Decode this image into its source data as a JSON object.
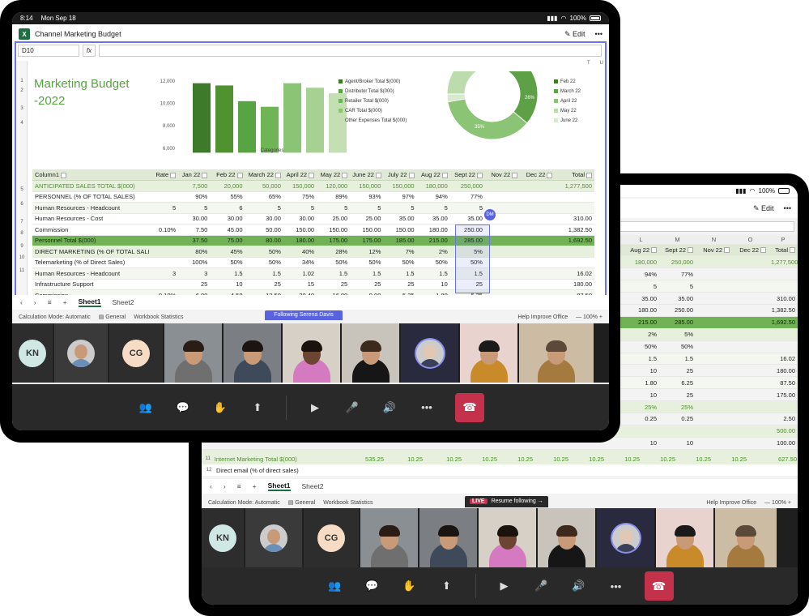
{
  "back": {
    "status": {
      "battery": "100%"
    },
    "title": {
      "edit": "Edit",
      "more": "•••"
    },
    "col_letters": [
      "K",
      "L",
      "M",
      "N",
      "O",
      "P"
    ],
    "header": [
      "Aug 22",
      "Sept 22",
      "Nov 22",
      "Dec 22",
      "Total"
    ],
    "rows": [
      [
        "180,000",
        "250,000",
        "",
        "",
        "1,277,500"
      ],
      [
        "94%",
        "77%",
        "",
        "",
        ""
      ],
      [
        "5",
        "5",
        "",
        "",
        ""
      ],
      [
        "35.00",
        "35.00",
        "",
        "",
        "310.00"
      ],
      [
        "180.00",
        "250.00",
        "",
        "",
        "1,382.50"
      ],
      [
        "215.00",
        "285.00",
        "",
        "",
        "1,692.50"
      ],
      [
        "2%",
        "5%",
        "",
        "",
        ""
      ],
      [
        "50%",
        "50%",
        "",
        "",
        ""
      ],
      [
        "1.5",
        "1.5",
        "",
        "",
        "16.02"
      ],
      [
        "10",
        "25",
        "",
        "",
        "180.00"
      ],
      [
        "1.80",
        "6.25",
        "",
        "",
        "87.50"
      ],
      [
        "10",
        "25",
        "",
        "",
        "175.00"
      ],
      [
        "25%",
        "25%",
        "",
        "",
        ""
      ],
      [
        "0.25",
        "0.25",
        "",
        "",
        "2.50"
      ],
      [
        "",
        "",
        "",
        "",
        "500.00"
      ],
      [
        "10",
        "10",
        "",
        "",
        "100.00"
      ],
      [
        "",
        "",
        "",
        "",
        "25.00"
      ]
    ],
    "internet_row": {
      "num": "11",
      "label": "Internet Marketing Total $(000)",
      "vals": [
        "535.25",
        "10.25",
        "10.25",
        "10.25",
        "10.25",
        "10.25",
        "10.25",
        "10.25",
        "10.25",
        "10.25",
        "10.25",
        "627.50"
      ]
    },
    "direct_row": {
      "num": "12",
      "label": "Direct email (% of direct sales)"
    },
    "sheets": [
      "Sheet1",
      "Sheet2"
    ],
    "statusbar": {
      "calc": "Calculation Mode: Automatic",
      "general": "General",
      "stats": "Workbook Statistics",
      "help": "Help Improve Office",
      "zoom": "100%"
    },
    "resume": {
      "live": "LIVE",
      "label": "Resume following"
    }
  },
  "front": {
    "status": {
      "time": "8:14",
      "date": "Mon Sep 18",
      "battery": "100%"
    },
    "title": {
      "app": "Channel Marketing Budget",
      "edit": "Edit",
      "more": "•••"
    },
    "cellref": "D10",
    "fx": "fx",
    "sheet_title": [
      "Marketing Budget",
      "-2022"
    ],
    "bar_chart": {
      "ylabels": [
        "12,000",
        "10,000",
        "8,000",
        "6,000"
      ],
      "xlabel": "Categories",
      "values": [
        11800,
        11600,
        10200,
        9700,
        11800,
        11400,
        10900
      ]
    },
    "bar_legend": [
      "Agent/Broker Total $(000)",
      "Distributor Total $(000)",
      "Retailer Total $(000)",
      "CAR Total $(000)",
      "Other Expenses Total $(000)"
    ],
    "pie": {
      "labels": [
        "26%",
        "35%"
      ]
    },
    "pie_legend": [
      "Feb 22",
      "March 22",
      "April 22",
      "May 22",
      "June 22"
    ],
    "col_letters_right": [
      "T",
      "U"
    ],
    "header": [
      "Column1",
      "Rate",
      "Jan 22",
      "Feb 22",
      "March 22",
      "April 22",
      "May 22",
      "June 22",
      "July 22",
      "Aug 22",
      "Sept 22",
      "Nov 22",
      "Dec 22",
      "Total"
    ],
    "rows": [
      {
        "c": "ant",
        "v": [
          "ANTICIPATED SALES TOTAL $(000)",
          "",
          "7,500",
          "20,000",
          "50,000",
          "150,000",
          "120,000",
          "150,000",
          "150,000",
          "180,000",
          "250,000",
          "",
          "",
          "1,277,500"
        ]
      },
      {
        "c": "",
        "v": [
          "PERSONNEL (% OF TOTAL SALES)",
          "",
          "90%",
          "55%",
          "65%",
          "75%",
          "89%",
          "93%",
          "97%",
          "94%",
          "77%",
          "",
          "",
          ""
        ]
      },
      {
        "c": "alt",
        "v": [
          "Human Resources - Headcount",
          "5",
          "5",
          "6",
          "5",
          "5",
          "5",
          "5",
          "5",
          "5",
          "5",
          "",
          "",
          ""
        ]
      },
      {
        "c": "",
        "v": [
          "Human Resources - Cost",
          "",
          "30.00",
          "30.00",
          "30.00",
          "30.00",
          "25.00",
          "25.00",
          "35.00",
          "35.00",
          "35.00",
          "",
          "",
          "310.00"
        ]
      },
      {
        "c": "",
        "v": [
          "Commission",
          "0.10%",
          "7.50",
          "45.00",
          "50.00",
          "150.00",
          "150.00",
          "150.00",
          "150.00",
          "180.00",
          "250.00",
          "",
          "",
          "1,382.50"
        ]
      },
      {
        "c": "pt",
        "v": [
          "Personnel Total $(000)",
          "",
          "37.50",
          "75.00",
          "80.00",
          "180.00",
          "175.00",
          "175.00",
          "185.00",
          "215.00",
          "285.00",
          "",
          "",
          "1,692.50"
        ]
      },
      {
        "c": "dm",
        "v": [
          "DIRECT MARKETING (% OF TOTAL SALES)",
          "",
          "80%",
          "45%",
          "50%",
          "40%",
          "28%",
          "12%",
          "7%",
          "2%",
          "5%",
          "",
          "",
          ""
        ]
      },
      {
        "c": "",
        "v": [
          "Telemarketing (% of Direct Sales)",
          "",
          "100%",
          "50%",
          "50%",
          "34%",
          "50%",
          "50%",
          "50%",
          "50%",
          "50%",
          "",
          "",
          ""
        ]
      },
      {
        "c": "alt",
        "v": [
          "Human Resources - Headcount",
          "3",
          "3",
          "1.5",
          "1.5",
          "1.02",
          "1.5",
          "1.5",
          "1.5",
          "1.5",
          "1.5",
          "",
          "",
          "16.02"
        ]
      },
      {
        "c": "",
        "v": [
          "Infrastructure Support",
          "",
          "25",
          "10",
          "25",
          "15",
          "25",
          "25",
          "25",
          "10",
          "25",
          "",
          "",
          "180.00"
        ]
      },
      {
        "c": "alt",
        "v": [
          "Commission",
          "0.10%",
          "6.00",
          "4.50",
          "12.50",
          "20.40",
          "16.80",
          "9.00",
          "5.25",
          "1.80",
          "6.25",
          "",
          "",
          "87.50"
        ]
      }
    ],
    "row_nums": [
      "1",
      "2",
      "3",
      "4",
      "5",
      "6",
      "7",
      "8",
      "9",
      "10",
      "11"
    ],
    "dm_badge": "DM",
    "sheets": [
      "Sheet1",
      "Sheet2"
    ],
    "statusbar": {
      "calc": "Calculation Mode: Automatic",
      "general": "General",
      "stats": "Workbook Statistics",
      "help": "Help Improve Office",
      "zoom": "100%"
    },
    "following": "Following Serena Davis"
  },
  "participants": {
    "avatars": [
      "KN",
      "CG"
    ],
    "avatar_colors": [
      "#cfe8e4",
      "#f6dcc4"
    ]
  }
}
